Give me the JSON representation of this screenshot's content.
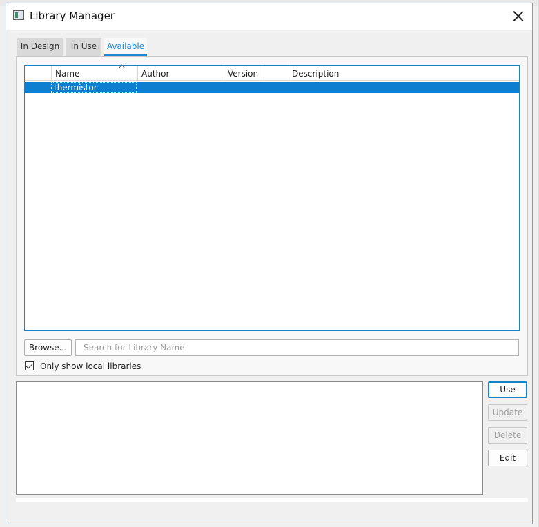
{
  "window": {
    "title": "Library Manager",
    "close_label": "×"
  },
  "tabs": [
    {
      "label": "In Design",
      "active": false
    },
    {
      "label": "In Use",
      "active": false
    },
    {
      "label": "Available",
      "active": true
    }
  ],
  "table": {
    "sort_column": "Name",
    "sort_direction": "ascending",
    "columns": [
      {
        "key": "blank",
        "label": ""
      },
      {
        "key": "name",
        "label": "Name"
      },
      {
        "key": "author",
        "label": "Author"
      },
      {
        "key": "version",
        "label": "Version"
      },
      {
        "key": "blank2",
        "label": ""
      },
      {
        "key": "description",
        "label": "Description"
      }
    ],
    "rows": [
      {
        "name": "thermistor",
        "author": "",
        "version": "",
        "description": "",
        "selected": true
      }
    ]
  },
  "browse_button": {
    "label": "Browse..."
  },
  "search": {
    "placeholder": "Search for Library Name",
    "value": ""
  },
  "only_local": {
    "label": "Only show local libraries",
    "checked": true
  },
  "actions": {
    "use": {
      "label": "Use",
      "enabled": true
    },
    "update": {
      "label": "Update",
      "enabled": false
    },
    "delete": {
      "label": "Delete",
      "enabled": false
    },
    "edit": {
      "label": "Edit",
      "enabled": true
    }
  },
  "colors": {
    "accent": "#1783c9",
    "selection": "#0e7fd0",
    "window_bg": "#f0f0f0"
  }
}
